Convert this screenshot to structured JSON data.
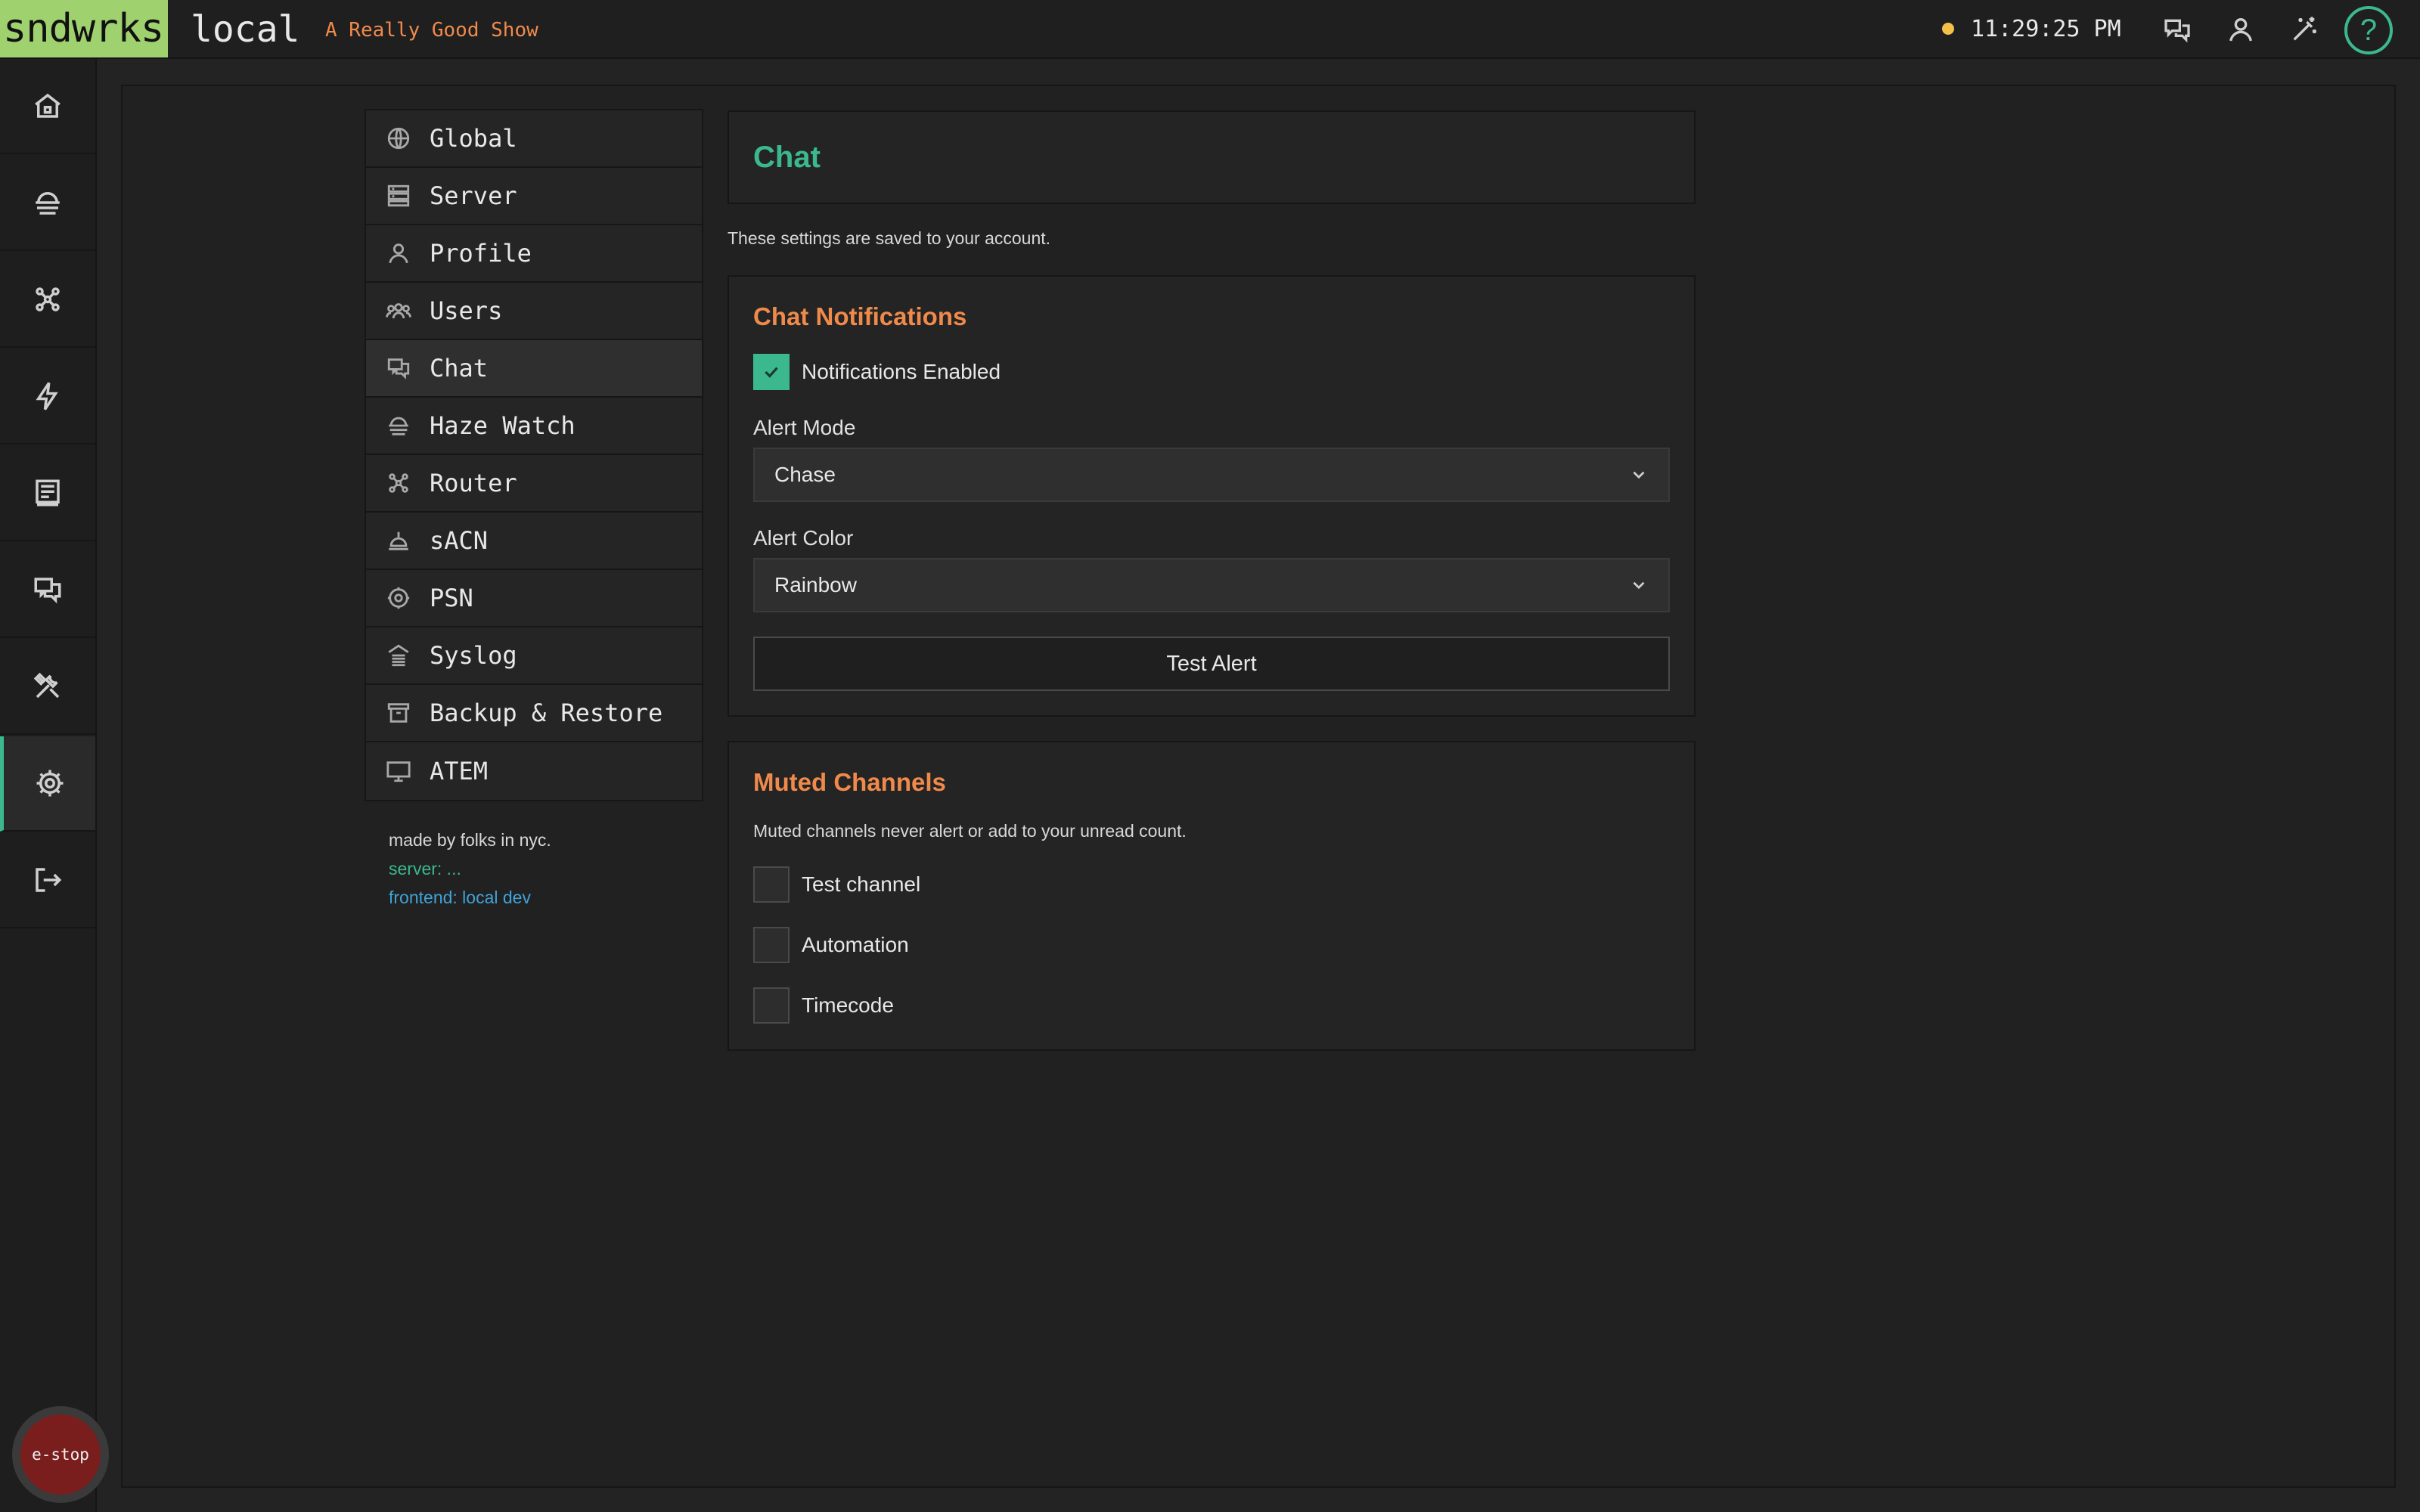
{
  "app": {
    "brand": "sndwrks",
    "instance": "local",
    "show_name": "A Really Good Show",
    "clock": "11:29:25 PM",
    "help_label": "?"
  },
  "topbar_icons": [
    "chat-icon",
    "user-icon",
    "magic-wand-icon",
    "help-icon"
  ],
  "rail": {
    "items": [
      "home-icon",
      "haze-icon",
      "router-icon",
      "lightning-icon",
      "monitor-icon",
      "chat-icon",
      "tools-icon",
      "gear-icon",
      "logout-icon"
    ],
    "active": "gear-icon",
    "estop_label": "e-stop"
  },
  "settings_nav": {
    "items": [
      {
        "label": "Global",
        "icon": "globe-icon"
      },
      {
        "label": "Server",
        "icon": "server-icon"
      },
      {
        "label": "Profile",
        "icon": "user-icon"
      },
      {
        "label": "Users",
        "icon": "users-icon"
      },
      {
        "label": "Chat",
        "icon": "chat-icon"
      },
      {
        "label": "Haze Watch",
        "icon": "haze-icon"
      },
      {
        "label": "Router",
        "icon": "router-icon"
      },
      {
        "label": "sACN",
        "icon": "lamp-icon"
      },
      {
        "label": "PSN",
        "icon": "target-icon"
      },
      {
        "label": "Syslog",
        "icon": "syslog-icon"
      },
      {
        "label": "Backup & Restore",
        "icon": "archive-icon"
      },
      {
        "label": "ATEM",
        "icon": "display-icon"
      }
    ],
    "active": "Chat"
  },
  "credits": {
    "made_by": "made by folks in nyc.",
    "server": "server: ...",
    "frontend": "frontend: local dev"
  },
  "page": {
    "title": "Chat",
    "account_note": "These settings are saved to your account."
  },
  "notifications": {
    "title": "Chat Notifications",
    "enabled_label": "Notifications Enabled",
    "enabled": true,
    "alert_mode_label": "Alert Mode",
    "alert_mode_value": "Chase",
    "alert_color_label": "Alert Color",
    "alert_color_value": "Rainbow",
    "test_button": "Test Alert"
  },
  "muted": {
    "title": "Muted Channels",
    "description": "Muted channels never alert or add to your unread count.",
    "channels": [
      {
        "label": "Test channel",
        "muted": false
      },
      {
        "label": "Automation",
        "muted": false
      },
      {
        "label": "Timecode",
        "muted": false
      }
    ]
  },
  "colors": {
    "brand_green": "#9fd26f",
    "accent_teal": "#3cb88f",
    "section_orange": "#f08a4b",
    "estop_red": "#7a1d1d",
    "status_yellow": "#f4c04a"
  }
}
